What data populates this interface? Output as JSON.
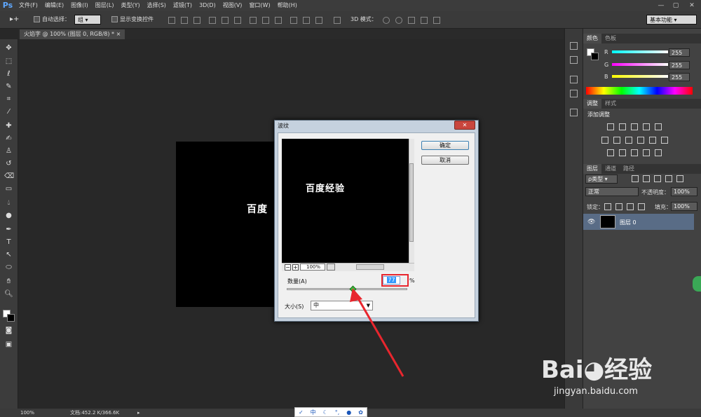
{
  "app": {
    "logo": "Ps"
  },
  "menu": [
    "文件(F)",
    "编辑(E)",
    "图像(I)",
    "图层(L)",
    "类型(Y)",
    "选择(S)",
    "滤镜(T)",
    "3D(D)",
    "视图(V)",
    "窗口(W)",
    "帮助(H)"
  ],
  "window_controls": [
    "—",
    "▢",
    "✕"
  ],
  "options": {
    "auto_select_label": "自动选择：",
    "auto_select_value": "组",
    "show_transform_label": "显示变换控件",
    "mode_3d_label": "3D 模式：",
    "workspace": "基本功能"
  },
  "document_tab": {
    "title": "火焰字 @ 100% (图层 0, RGB/8) *",
    "close": "×"
  },
  "canvas": {
    "text": "百度"
  },
  "panels": {
    "color_tabs": [
      "颜色",
      "色板"
    ],
    "channels": [
      {
        "label": "R",
        "value": "255",
        "color": "#3fd0d8"
      },
      {
        "label": "G",
        "value": "255",
        "color": "#d040d0"
      },
      {
        "label": "B",
        "value": "255",
        "color": "#e8e830"
      }
    ],
    "adjust_tabs": [
      "调整",
      "样式"
    ],
    "adjust_title": "添加调整",
    "layer_tabs": [
      "图层",
      "通道",
      "路径"
    ],
    "layer_filter": "ρ类型",
    "blend_mode": "正常",
    "opacity_label": "不透明度：",
    "opacity_value": "100%",
    "lock_label": "锁定：",
    "fill_label": "填充：",
    "fill_value": "100%",
    "layer_name": "图层 0"
  },
  "status": {
    "zoom": "100%",
    "doc": "文档:452.2 K/366.6K"
  },
  "dialog": {
    "title": "波纹",
    "close": "✕",
    "preview_text": "百度经验",
    "zoom": "100%",
    "ok": "确定",
    "cancel": "取消",
    "amount_label": "数量(A)",
    "amount_value": "77",
    "amount_suffix": "%",
    "amount_level": 0.55,
    "size_label": "大小(S)",
    "size_value": "中"
  },
  "ime": [
    "中",
    "☾",
    "°,",
    "●",
    "✿"
  ],
  "watermark": {
    "logo": "Bai◕经验",
    "url": "jingyan.baidu.com"
  }
}
